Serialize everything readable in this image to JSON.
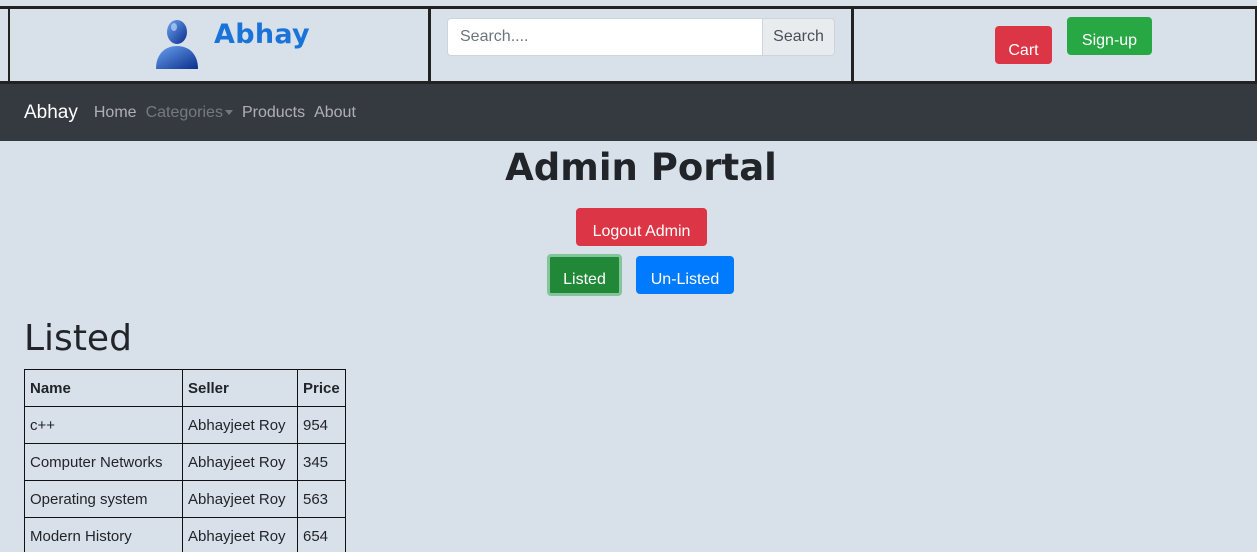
{
  "brand": {
    "name": "Abhay"
  },
  "search": {
    "placeholder": "Search....",
    "button_label": "Search"
  },
  "actions": {
    "cart_label": "Cart",
    "signup_label": "Sign-up"
  },
  "navbar": {
    "brand": "Abhay",
    "links": [
      {
        "label": "Home",
        "disabled": false
      },
      {
        "label": "Categories",
        "disabled": true
      },
      {
        "label": "Products",
        "disabled": false
      },
      {
        "label": "About",
        "disabled": false
      }
    ]
  },
  "page": {
    "title": "Admin Portal",
    "logout_label": "Logout Admin",
    "listed_label": "Listed",
    "unlisted_label": "Un-Listed",
    "section_title": "Listed"
  },
  "table": {
    "headers": [
      "Name",
      "Seller",
      "Price"
    ],
    "rows": [
      [
        "c++",
        "Abhayjeet Roy",
        "954"
      ],
      [
        "Computer Networks",
        "Abhayjeet Roy",
        "345"
      ],
      [
        "Operating system",
        "Abhayjeet Roy",
        "563"
      ],
      [
        "Modern History",
        "Abhayjeet Roy",
        "654"
      ]
    ]
  },
  "colors": {
    "brand_blue": "#1a73d9",
    "danger": "#dc3545",
    "success": "#28a745",
    "primary": "#007bff",
    "navbar": "#343a40",
    "page_bg": "#d8e1ea"
  }
}
